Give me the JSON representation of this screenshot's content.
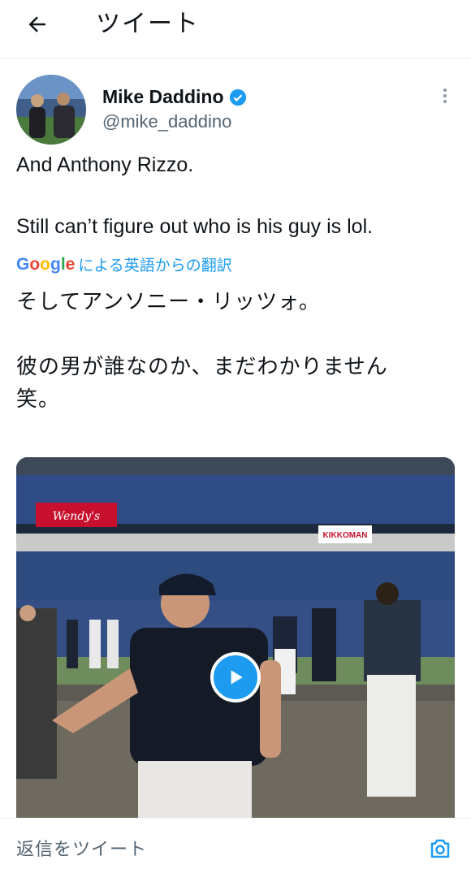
{
  "header": {
    "title": "ツイート",
    "back_icon": "arrow-left-icon"
  },
  "author": {
    "display_name": "Mike Daddino",
    "handle": "@mike_daddino",
    "verified_color": "#1d9bf0"
  },
  "tweet": {
    "line1": "And Anthony Rizzo.",
    "line2": "Still can’t figure out who is his guy is lol."
  },
  "translation": {
    "google_label": "Google",
    "label": "による英語からの翻訳",
    "line1": "そしてアンソニー・リッツォ。",
    "line2": "彼の男が誰なのか、まだわかりません",
    "line3": "笑。"
  },
  "media": {
    "banner_wendys": "Wendy's",
    "banner_kikkoman": "KIKKOMAN",
    "play_icon": "play-icon"
  },
  "reply": {
    "placeholder": "返信をツイート",
    "camera_icon": "camera-icon"
  },
  "colors": {
    "accent": "#1d9bf0",
    "secondary_text": "#536471"
  }
}
